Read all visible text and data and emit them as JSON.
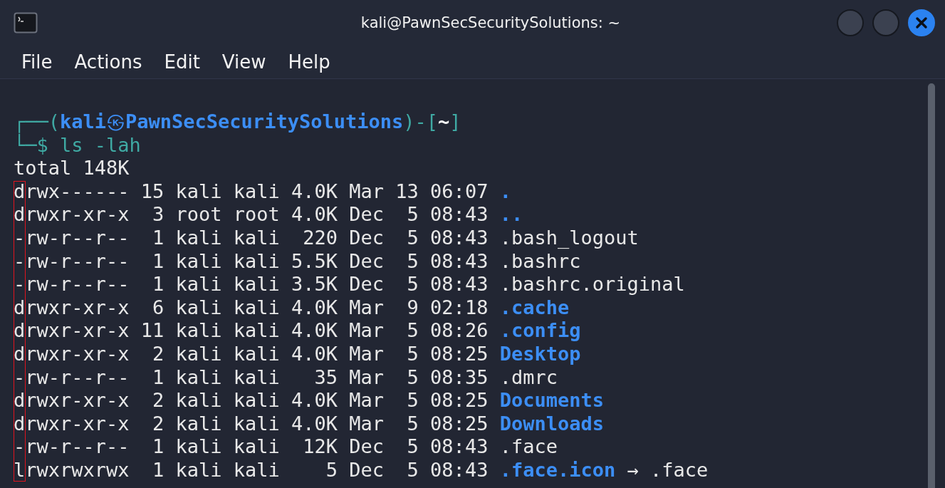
{
  "window": {
    "title": "kali@PawnSecSecuritySolutions: ~"
  },
  "menu": [
    "File",
    "Actions",
    "Edit",
    "View",
    "Help"
  ],
  "prompt": {
    "line1_prefix": "┌──(",
    "user": "kali",
    "separator": "㉿",
    "host": "PawnSecSecuritySolutions",
    "cwd_open": ")-[",
    "cwd": "~",
    "cwd_close": "]",
    "line2_prefix": "└─$",
    "command": "ls -lah"
  },
  "total": "total 148K",
  "rows": [
    {
      "perms": "drwx------",
      "links": "15",
      "owner": "kali",
      "group": "kali",
      "size": "4.0K",
      "month": "Mar",
      "day": "13",
      "time": "06:07",
      "name": ".",
      "kind": "dir"
    },
    {
      "perms": "drwxr-xr-x",
      "links": "3",
      "owner": "root",
      "group": "root",
      "size": "4.0K",
      "month": "Dec",
      "day": "5",
      "time": "08:43",
      "name": "..",
      "kind": "dir"
    },
    {
      "perms": "-rw-r--r--",
      "links": "1",
      "owner": "kali",
      "group": "kali",
      "size": "220",
      "month": "Dec",
      "day": "5",
      "time": "08:43",
      "name": ".bash_logout",
      "kind": "file"
    },
    {
      "perms": "-rw-r--r--",
      "links": "1",
      "owner": "kali",
      "group": "kali",
      "size": "5.5K",
      "month": "Dec",
      "day": "5",
      "time": "08:43",
      "name": ".bashrc",
      "kind": "file"
    },
    {
      "perms": "-rw-r--r--",
      "links": "1",
      "owner": "kali",
      "group": "kali",
      "size": "3.5K",
      "month": "Dec",
      "day": "5",
      "time": "08:43",
      "name": ".bashrc.original",
      "kind": "file"
    },
    {
      "perms": "drwxr-xr-x",
      "links": "6",
      "owner": "kali",
      "group": "kali",
      "size": "4.0K",
      "month": "Mar",
      "day": "9",
      "time": "02:18",
      "name": ".cache",
      "kind": "dir"
    },
    {
      "perms": "drwxr-xr-x",
      "links": "11",
      "owner": "kali",
      "group": "kali",
      "size": "4.0K",
      "month": "Mar",
      "day": "5",
      "time": "08:26",
      "name": ".config",
      "kind": "dir"
    },
    {
      "perms": "drwxr-xr-x",
      "links": "2",
      "owner": "kali",
      "group": "kali",
      "size": "4.0K",
      "month": "Mar",
      "day": "5",
      "time": "08:25",
      "name": "Desktop",
      "kind": "dir"
    },
    {
      "perms": "-rw-r--r--",
      "links": "1",
      "owner": "kali",
      "group": "kali",
      "size": "35",
      "month": "Mar",
      "day": "5",
      "time": "08:35",
      "name": ".dmrc",
      "kind": "file"
    },
    {
      "perms": "drwxr-xr-x",
      "links": "2",
      "owner": "kali",
      "group": "kali",
      "size": "4.0K",
      "month": "Mar",
      "day": "5",
      "time": "08:25",
      "name": "Documents",
      "kind": "dir"
    },
    {
      "perms": "drwxr-xr-x",
      "links": "2",
      "owner": "kali",
      "group": "kali",
      "size": "4.0K",
      "month": "Mar",
      "day": "5",
      "time": "08:25",
      "name": "Downloads",
      "kind": "dir"
    },
    {
      "perms": "-rw-r--r--",
      "links": "1",
      "owner": "kali",
      "group": "kali",
      "size": "12K",
      "month": "Dec",
      "day": "5",
      "time": "08:43",
      "name": ".face",
      "kind": "file"
    },
    {
      "perms": "lrwxrwxrwx",
      "links": "1",
      "owner": "kali",
      "group": "kali",
      "size": "5",
      "month": "Dec",
      "day": "5",
      "time": "08:43",
      "name": ".face.icon",
      "kind": "link",
      "arrow": "→",
      "target": ".face"
    }
  ]
}
